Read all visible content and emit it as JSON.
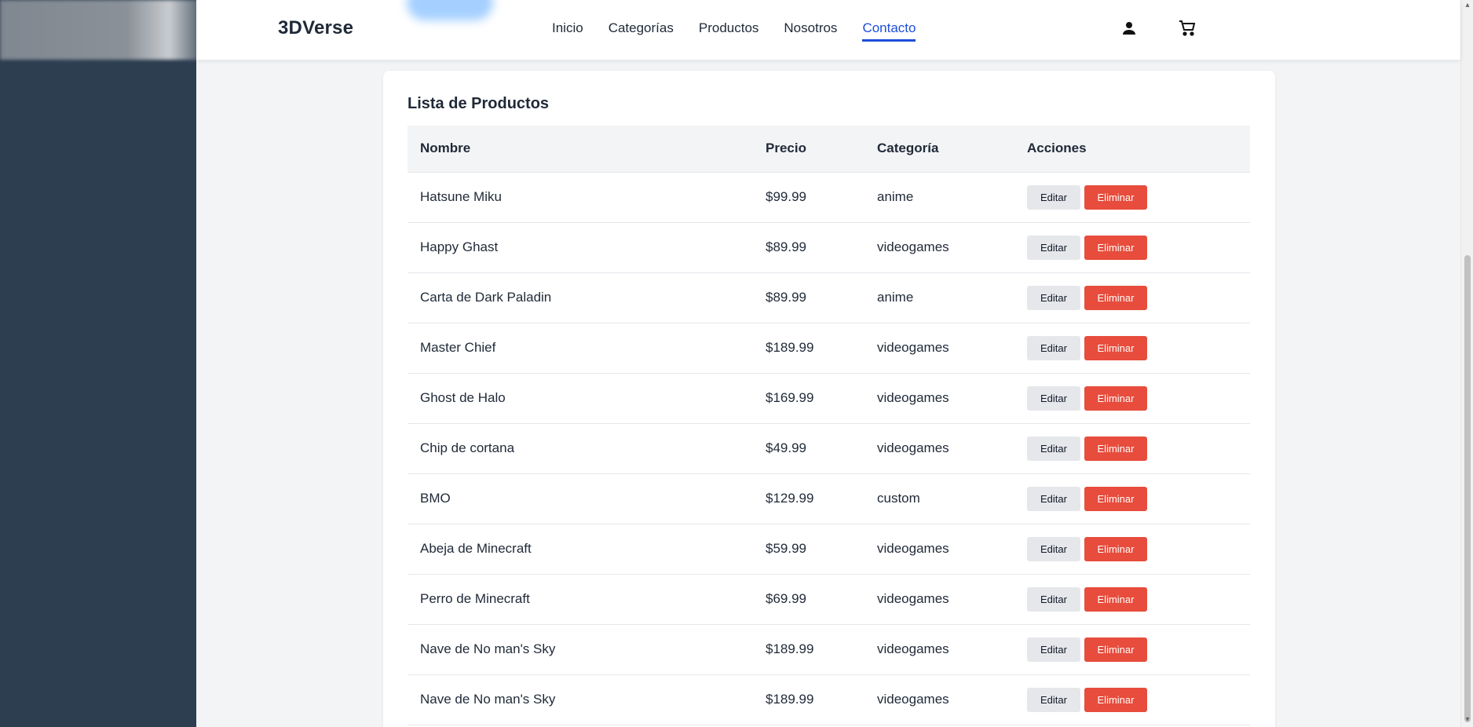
{
  "header": {
    "brand": "3DVerse",
    "nav": [
      "Inicio",
      "Categorías",
      "Productos",
      "Nosotros",
      "Contacto"
    ],
    "active_nav": "Contacto",
    "icons": [
      "user-icon",
      "cart-icon"
    ]
  },
  "card": {
    "title": "Lista de Productos",
    "columns": [
      "Nombre",
      "Precio",
      "Categoría",
      "Acciones"
    ],
    "rows": [
      {
        "name": "Hatsune Miku",
        "price": "$99.99",
        "category": "anime"
      },
      {
        "name": "Happy Ghast",
        "price": "$89.99",
        "category": "videogames"
      },
      {
        "name": "Carta de Dark Paladin",
        "price": "$89.99",
        "category": "anime"
      },
      {
        "name": "Master Chief",
        "price": "$189.99",
        "category": "videogames"
      },
      {
        "name": "Ghost de Halo",
        "price": "$169.99",
        "category": "videogames"
      },
      {
        "name": "Chip de cortana",
        "price": "$49.99",
        "category": "videogames"
      },
      {
        "name": "BMO",
        "price": "$129.99",
        "category": "custom"
      },
      {
        "name": "Abeja de Minecraft",
        "price": "$59.99",
        "category": "videogames"
      },
      {
        "name": "Perro de Minecraft",
        "price": "$69.99",
        "category": "videogames"
      },
      {
        "name": "Nave de No man's Sky",
        "price": "$189.99",
        "category": "videogames"
      },
      {
        "name": "Nave de No man's Sky",
        "price": "$189.99",
        "category": "videogames"
      }
    ],
    "edit_label": "Editar",
    "delete_label": "Eliminar"
  },
  "colors": {
    "sidebar": "#2c3e50",
    "accent": "#1d4ed8",
    "delete": "#e74c3c"
  }
}
